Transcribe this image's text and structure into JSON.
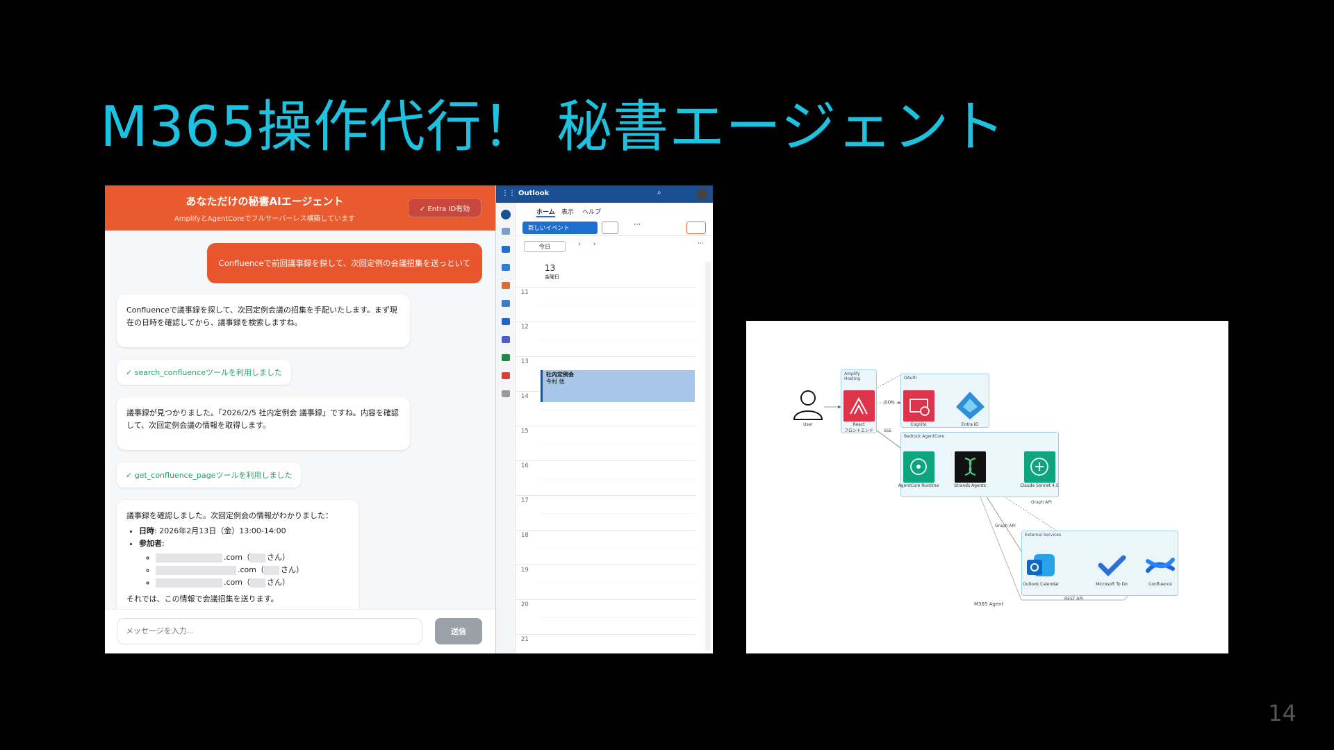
{
  "slide": {
    "title": "M365操作代行！ 秘書エージェント",
    "page_number": "14"
  },
  "chat": {
    "header_title": "あなただけの秘書AIエージェント",
    "header_subtitle": "AmplifyとAgentCoreでフルサーバーレス構築しています",
    "auth_button": "✓ Entra ID有効",
    "user_message": "Confluenceで前回議事録を探して、次回定例の会議招集を送っといて",
    "ai_message_1": "Confluenceで議事録を探して、次回定例会議の招集を手配いたします。まず現在の日時を確認してから、議事録を検索しますね。",
    "tool_1": "✓ search_confluenceツールを利用しました",
    "ai_message_2": "議事録が見つかりました。「2026/2/5 社内定例会 議事録」ですね。内容を確認して、次回定例会議の情報を取得します。",
    "tool_2": "✓ get_confluence_pageツールを利用しました",
    "ai_message_3_intro": "議事録を確認しました。次回定例会の情報がわかりました：",
    "date_label": "日時",
    "date_value": ": 2026年2月13日（金）13:00-14:00",
    "attendees_label": "参加者",
    "attendee_domain": ".com（",
    "attendee_suffix": "さん）",
    "ai_message_3_outro": "それでは、この情報で会議招集を送ります。",
    "input_placeholder": "メッセージを入力...",
    "send_button": "送信"
  },
  "outlook": {
    "app_name": "Outlook",
    "tabs": [
      "ホーム",
      "表示",
      "ヘルプ"
    ],
    "new_event": "新しいイベント",
    "today": "今日",
    "day_number": "13",
    "day_name": "金曜日",
    "hours": [
      "11",
      "12",
      "13",
      "14",
      "15",
      "16",
      "17",
      "18",
      "19",
      "20",
      "21"
    ],
    "event_title": "社内定例会",
    "event_sub": "今村 他"
  },
  "architecture": {
    "groups": {
      "amplify": "Amplify Hosting",
      "cognito_group": "OAuth",
      "agentcore": "Bedrock AgentCore",
      "external": "External Services"
    },
    "nodes": {
      "user": "User",
      "react": "React",
      "react_sub": "フロントエンド",
      "cognito": "Cognito",
      "entra": "Entra ID",
      "agentcore_runtime": "AgentCore Runtime",
      "strands": "Strands Agents",
      "claude": "Claude Sonnet 4.5",
      "outlook_cal": "Outlook Calendar",
      "ms_todo": "Microsoft To Do",
      "confluence": "Confluence"
    },
    "edges": {
      "json": "JSON",
      "sse": "SSE",
      "graph_api": "Graph API",
      "graph_api_2": "Graph API",
      "rest_api": "REST API"
    },
    "footer": "M365 Agent"
  }
}
